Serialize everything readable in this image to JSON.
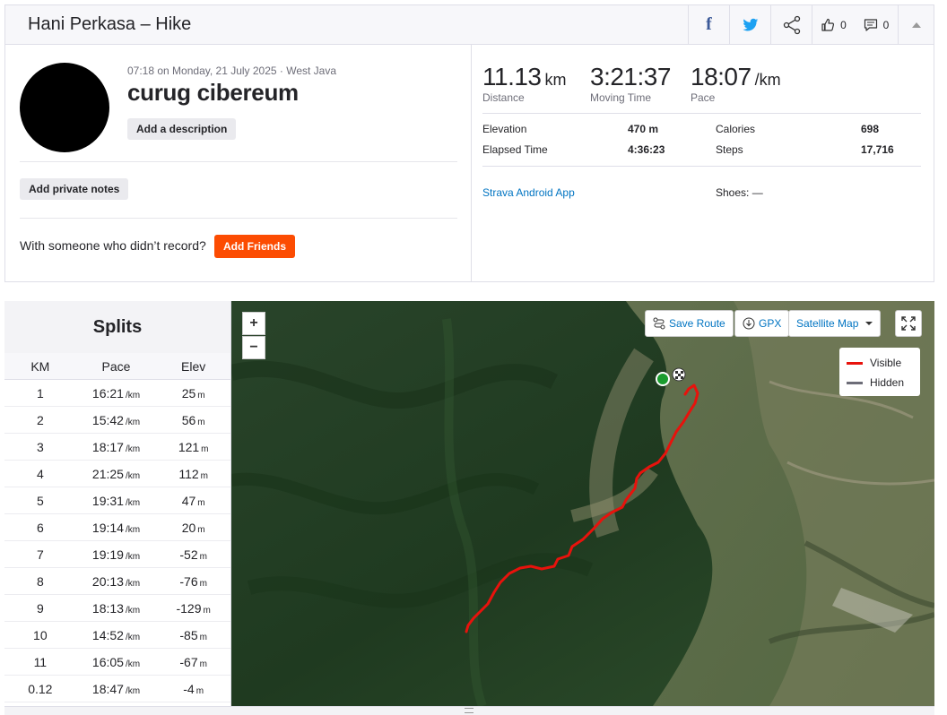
{
  "header": {
    "title": "Hani Perkasa – Hike",
    "kudos_count": "0",
    "comment_count": "0"
  },
  "activity": {
    "meta": "07:18 on Monday, 21 July 2025 · West Java",
    "title": "curug cibereum",
    "add_description": "Add a description",
    "add_private_notes": "Add private notes",
    "with_someone": "With someone who didn’t record?",
    "add_friends": "Add Friends"
  },
  "stats": {
    "distance": {
      "value": "11.13",
      "unit": "km",
      "label": "Distance"
    },
    "moving_time": {
      "value": "3:21:37",
      "label": "Moving Time"
    },
    "pace": {
      "value": "18:07",
      "unit": "/km",
      "label": "Pace"
    },
    "elevation": {
      "label": "Elevation",
      "value": "470 m"
    },
    "elapsed_time": {
      "label": "Elapsed Time",
      "value": "4:36:23"
    },
    "calories": {
      "label": "Calories",
      "value": "698"
    },
    "steps": {
      "label": "Steps",
      "value": "17,716"
    },
    "device": "Strava Android App",
    "shoes": "Shoes: —"
  },
  "splits": {
    "title": "Splits",
    "headers": {
      "km": "KM",
      "pace": "Pace",
      "elev": "Elev"
    },
    "pace_unit": "/km",
    "elev_unit": "m",
    "rows": [
      {
        "km": "1",
        "pace": "16:21",
        "elev": "25"
      },
      {
        "km": "2",
        "pace": "15:42",
        "elev": "56"
      },
      {
        "km": "3",
        "pace": "18:17",
        "elev": "121"
      },
      {
        "km": "4",
        "pace": "21:25",
        "elev": "112"
      },
      {
        "km": "5",
        "pace": "19:31",
        "elev": "47"
      },
      {
        "km": "6",
        "pace": "19:14",
        "elev": "20"
      },
      {
        "km": "7",
        "pace": "19:19",
        "elev": "-52"
      },
      {
        "km": "8",
        "pace": "20:13",
        "elev": "-76"
      },
      {
        "km": "9",
        "pace": "18:13",
        "elev": "-129"
      },
      {
        "km": "10",
        "pace": "14:52",
        "elev": "-85"
      },
      {
        "km": "11",
        "pace": "16:05",
        "elev": "-67"
      },
      {
        "km": "0.12",
        "pace": "18:47",
        "elev": "-4"
      }
    ]
  },
  "map": {
    "zoom_in": "+",
    "zoom_out": "−",
    "save_route": "Save Route",
    "gpx": "GPX",
    "map_type": "Satellite Map",
    "legend": {
      "visible": "Visible",
      "hidden": "Hidden"
    },
    "route_color": "#e8120c",
    "hidden_color": "#6d6d78"
  },
  "colors": {
    "brand": "#fc4c02",
    "link": "#0074c2",
    "facebook": "#3b5998",
    "twitter": "#1da1f2"
  }
}
